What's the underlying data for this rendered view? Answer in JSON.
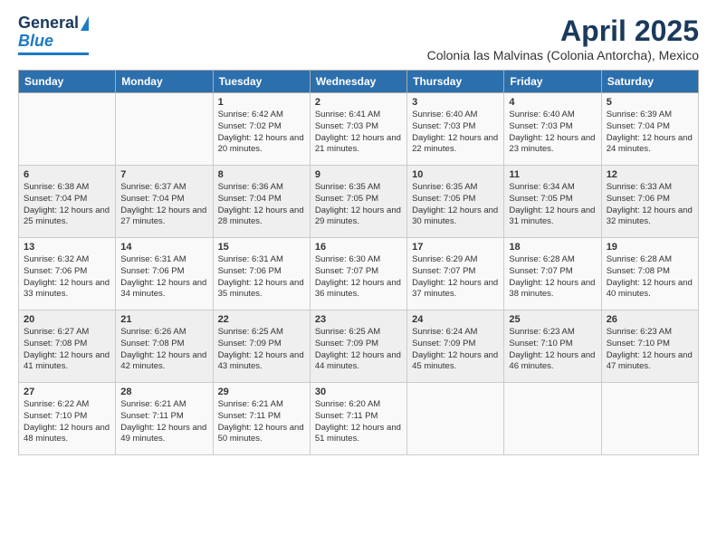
{
  "logo": {
    "line1": "General",
    "line2": "Blue"
  },
  "title": "April 2025",
  "subtitle": "Colonia las Malvinas (Colonia Antorcha), Mexico",
  "days_of_week": [
    "Sunday",
    "Monday",
    "Tuesday",
    "Wednesday",
    "Thursday",
    "Friday",
    "Saturday"
  ],
  "weeks": [
    [
      {
        "day": "",
        "info": ""
      },
      {
        "day": "",
        "info": ""
      },
      {
        "day": "1",
        "info": "Sunrise: 6:42 AM\nSunset: 7:02 PM\nDaylight: 12 hours and 20 minutes."
      },
      {
        "day": "2",
        "info": "Sunrise: 6:41 AM\nSunset: 7:03 PM\nDaylight: 12 hours and 21 minutes."
      },
      {
        "day": "3",
        "info": "Sunrise: 6:40 AM\nSunset: 7:03 PM\nDaylight: 12 hours and 22 minutes."
      },
      {
        "day": "4",
        "info": "Sunrise: 6:40 AM\nSunset: 7:03 PM\nDaylight: 12 hours and 23 minutes."
      },
      {
        "day": "5",
        "info": "Sunrise: 6:39 AM\nSunset: 7:04 PM\nDaylight: 12 hours and 24 minutes."
      }
    ],
    [
      {
        "day": "6",
        "info": "Sunrise: 6:38 AM\nSunset: 7:04 PM\nDaylight: 12 hours and 25 minutes."
      },
      {
        "day": "7",
        "info": "Sunrise: 6:37 AM\nSunset: 7:04 PM\nDaylight: 12 hours and 27 minutes."
      },
      {
        "day": "8",
        "info": "Sunrise: 6:36 AM\nSunset: 7:04 PM\nDaylight: 12 hours and 28 minutes."
      },
      {
        "day": "9",
        "info": "Sunrise: 6:35 AM\nSunset: 7:05 PM\nDaylight: 12 hours and 29 minutes."
      },
      {
        "day": "10",
        "info": "Sunrise: 6:35 AM\nSunset: 7:05 PM\nDaylight: 12 hours and 30 minutes."
      },
      {
        "day": "11",
        "info": "Sunrise: 6:34 AM\nSunset: 7:05 PM\nDaylight: 12 hours and 31 minutes."
      },
      {
        "day": "12",
        "info": "Sunrise: 6:33 AM\nSunset: 7:06 PM\nDaylight: 12 hours and 32 minutes."
      }
    ],
    [
      {
        "day": "13",
        "info": "Sunrise: 6:32 AM\nSunset: 7:06 PM\nDaylight: 12 hours and 33 minutes."
      },
      {
        "day": "14",
        "info": "Sunrise: 6:31 AM\nSunset: 7:06 PM\nDaylight: 12 hours and 34 minutes."
      },
      {
        "day": "15",
        "info": "Sunrise: 6:31 AM\nSunset: 7:06 PM\nDaylight: 12 hours and 35 minutes."
      },
      {
        "day": "16",
        "info": "Sunrise: 6:30 AM\nSunset: 7:07 PM\nDaylight: 12 hours and 36 minutes."
      },
      {
        "day": "17",
        "info": "Sunrise: 6:29 AM\nSunset: 7:07 PM\nDaylight: 12 hours and 37 minutes."
      },
      {
        "day": "18",
        "info": "Sunrise: 6:28 AM\nSunset: 7:07 PM\nDaylight: 12 hours and 38 minutes."
      },
      {
        "day": "19",
        "info": "Sunrise: 6:28 AM\nSunset: 7:08 PM\nDaylight: 12 hours and 40 minutes."
      }
    ],
    [
      {
        "day": "20",
        "info": "Sunrise: 6:27 AM\nSunset: 7:08 PM\nDaylight: 12 hours and 41 minutes."
      },
      {
        "day": "21",
        "info": "Sunrise: 6:26 AM\nSunset: 7:08 PM\nDaylight: 12 hours and 42 minutes."
      },
      {
        "day": "22",
        "info": "Sunrise: 6:25 AM\nSunset: 7:09 PM\nDaylight: 12 hours and 43 minutes."
      },
      {
        "day": "23",
        "info": "Sunrise: 6:25 AM\nSunset: 7:09 PM\nDaylight: 12 hours and 44 minutes."
      },
      {
        "day": "24",
        "info": "Sunrise: 6:24 AM\nSunset: 7:09 PM\nDaylight: 12 hours and 45 minutes."
      },
      {
        "day": "25",
        "info": "Sunrise: 6:23 AM\nSunset: 7:10 PM\nDaylight: 12 hours and 46 minutes."
      },
      {
        "day": "26",
        "info": "Sunrise: 6:23 AM\nSunset: 7:10 PM\nDaylight: 12 hours and 47 minutes."
      }
    ],
    [
      {
        "day": "27",
        "info": "Sunrise: 6:22 AM\nSunset: 7:10 PM\nDaylight: 12 hours and 48 minutes."
      },
      {
        "day": "28",
        "info": "Sunrise: 6:21 AM\nSunset: 7:11 PM\nDaylight: 12 hours and 49 minutes."
      },
      {
        "day": "29",
        "info": "Sunrise: 6:21 AM\nSunset: 7:11 PM\nDaylight: 12 hours and 50 minutes."
      },
      {
        "day": "30",
        "info": "Sunrise: 6:20 AM\nSunset: 7:11 PM\nDaylight: 12 hours and 51 minutes."
      },
      {
        "day": "",
        "info": ""
      },
      {
        "day": "",
        "info": ""
      },
      {
        "day": "",
        "info": ""
      }
    ]
  ]
}
